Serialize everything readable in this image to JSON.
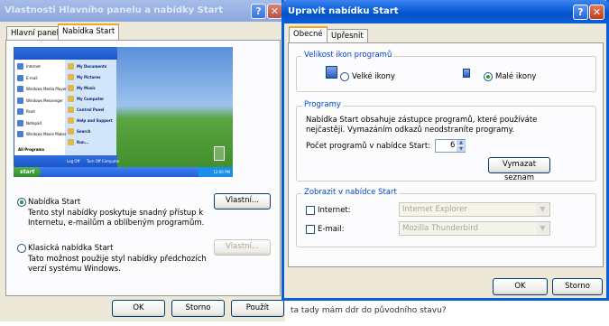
{
  "background_text": "ta tady mám ddr do původního stavu?",
  "back_window": {
    "title": "Vlastnosti Hlavního panelu a nabídky Start",
    "tabs": [
      "Hlavní panel",
      "Nabídka Start"
    ],
    "preview": {
      "start_label": "start",
      "left_items": [
        "Internet",
        "E-mail",
        "Windows Media Player",
        "Windows Messenger",
        "Paint",
        "Notepad",
        "Windows Movie Maker"
      ],
      "all_programs": "All Programs",
      "right_items": [
        "My Documents",
        "My Pictures",
        "My Music",
        "My Computer",
        "Control Panel",
        "Help and Support",
        "Search",
        "Run..."
      ],
      "logoff": "Log Off",
      "turnoff": "Turn Off Computer",
      "clock": "12:00 PM"
    },
    "option_start": {
      "label": "Nabídka Start",
      "desc1": "Tento styl nabídky poskytuje snadný přístup k",
      "desc2": "Internetu, e-mailům a oblíbeným programům."
    },
    "option_classic": {
      "label": "Klasická nabídka Start",
      "desc1": "Tato možnost použije styl nabídky předchozích",
      "desc2": "verzí systému Windows."
    },
    "customize_label": "Vlastní...",
    "customize2_label": "Vlastní...",
    "ok": "OK",
    "cancel": "Storno",
    "apply": "Použít"
  },
  "front_window": {
    "title": "Upravit nabídku Start",
    "tabs": [
      "Obecné",
      "Upřesnit"
    ],
    "icon_size": {
      "title": "Velikost ikon programů",
      "large": "Velké ikony",
      "small": "Malé ikony",
      "selected": "small"
    },
    "programs": {
      "title": "Programy",
      "desc1": "Nabídka Start obsahuje zástupce programů, které používáte",
      "desc2": "nejčastěji. Vymazáním odkazů neodstraníte programy.",
      "count_label": "Počet programů v nabídce Start:",
      "count_value": "6",
      "clear_label": "Vymazat seznam"
    },
    "show": {
      "title": "Zobrazit v nabídce Start",
      "internet_label": "Internet:",
      "internet_value": "Internet Explorer",
      "email_label": "E-mail:",
      "email_value": "Mozilla Thunderbird"
    },
    "ok": "OK",
    "cancel": "Storno"
  },
  "colors": {
    "xp_blue": "#0a5fd8",
    "dialog_bg": "#ece9d8",
    "group_title": "#0046d5"
  }
}
